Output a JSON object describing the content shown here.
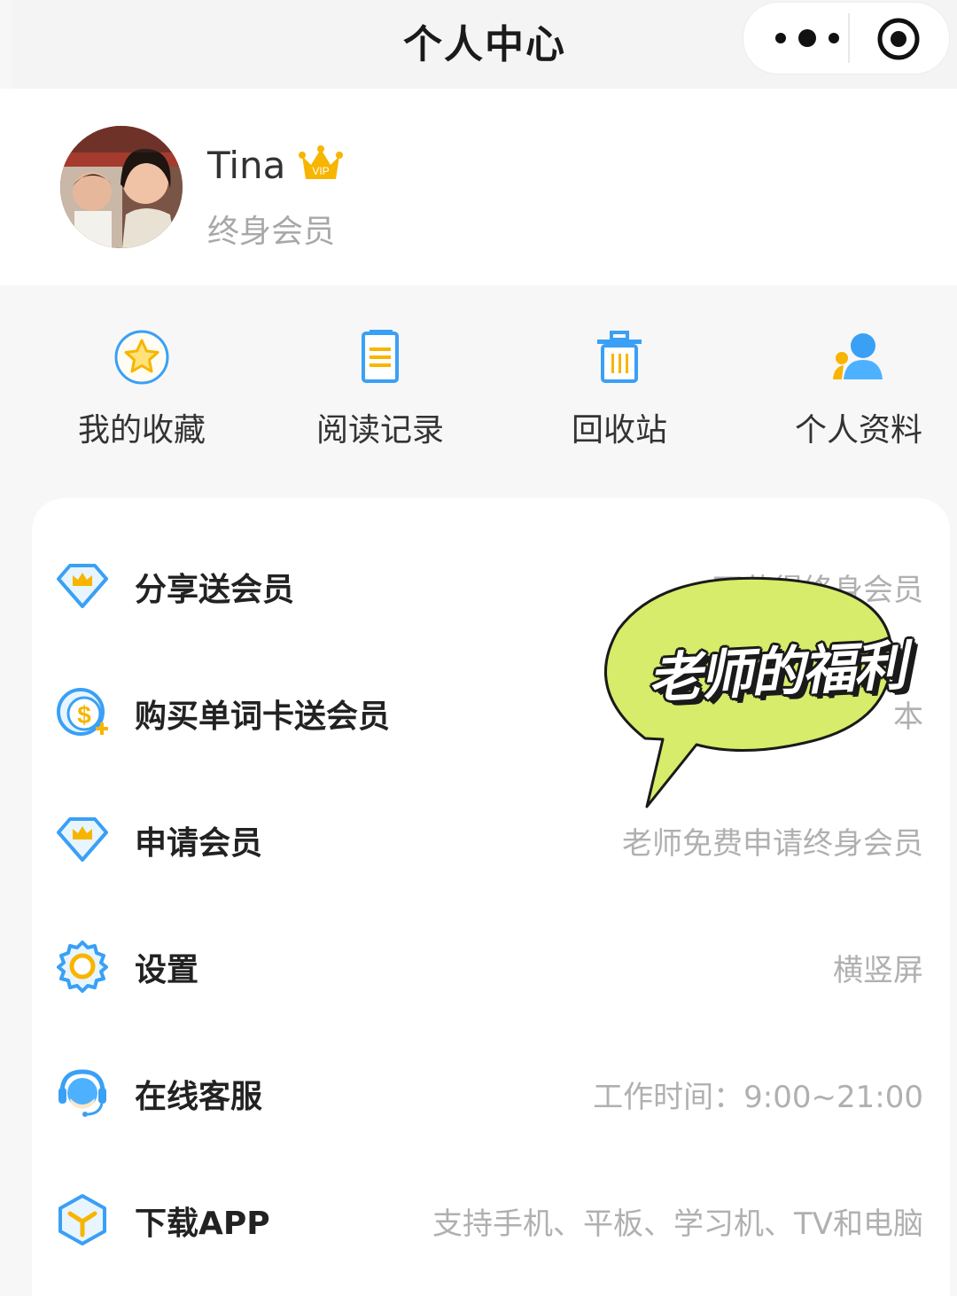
{
  "header": {
    "title": "个人中心",
    "more_icon": "more-dots-icon",
    "close_icon": "target-close-icon"
  },
  "profile": {
    "username": "Tina",
    "badge": "VIP",
    "member_level": "终身会员"
  },
  "quick_actions": [
    {
      "label": "我的收藏",
      "icon": "star-icon"
    },
    {
      "label": "阅读记录",
      "icon": "document-icon"
    },
    {
      "label": "回收站",
      "icon": "trash-icon"
    },
    {
      "label": "个人资料",
      "icon": "user-profile-icon"
    }
  ],
  "menu": [
    {
      "title": "分享送会员",
      "desc": "可获得终身会员",
      "icon": "diamond-crown-icon"
    },
    {
      "title": "购买单词卡送会员",
      "desc": "本",
      "icon": "coin-plus-icon"
    },
    {
      "title": "申请会员",
      "desc": "老师免费申请终身会员",
      "icon": "diamond-crown-icon"
    },
    {
      "title": "设置",
      "desc": "横竖屏",
      "icon": "gear-icon"
    },
    {
      "title": "在线客服",
      "desc": "工作时间：9:00~21:00",
      "icon": "headset-icon"
    },
    {
      "title": "下载APP",
      "desc": "支持手机、平板、学习机、TV和电脑",
      "icon": "box-download-icon"
    }
  ],
  "sticker": {
    "text": "老师的福利"
  },
  "colors": {
    "accent_blue": "#3aa0f5",
    "accent_yellow": "#f7b500",
    "sticker_green": "#d6ec6a"
  }
}
